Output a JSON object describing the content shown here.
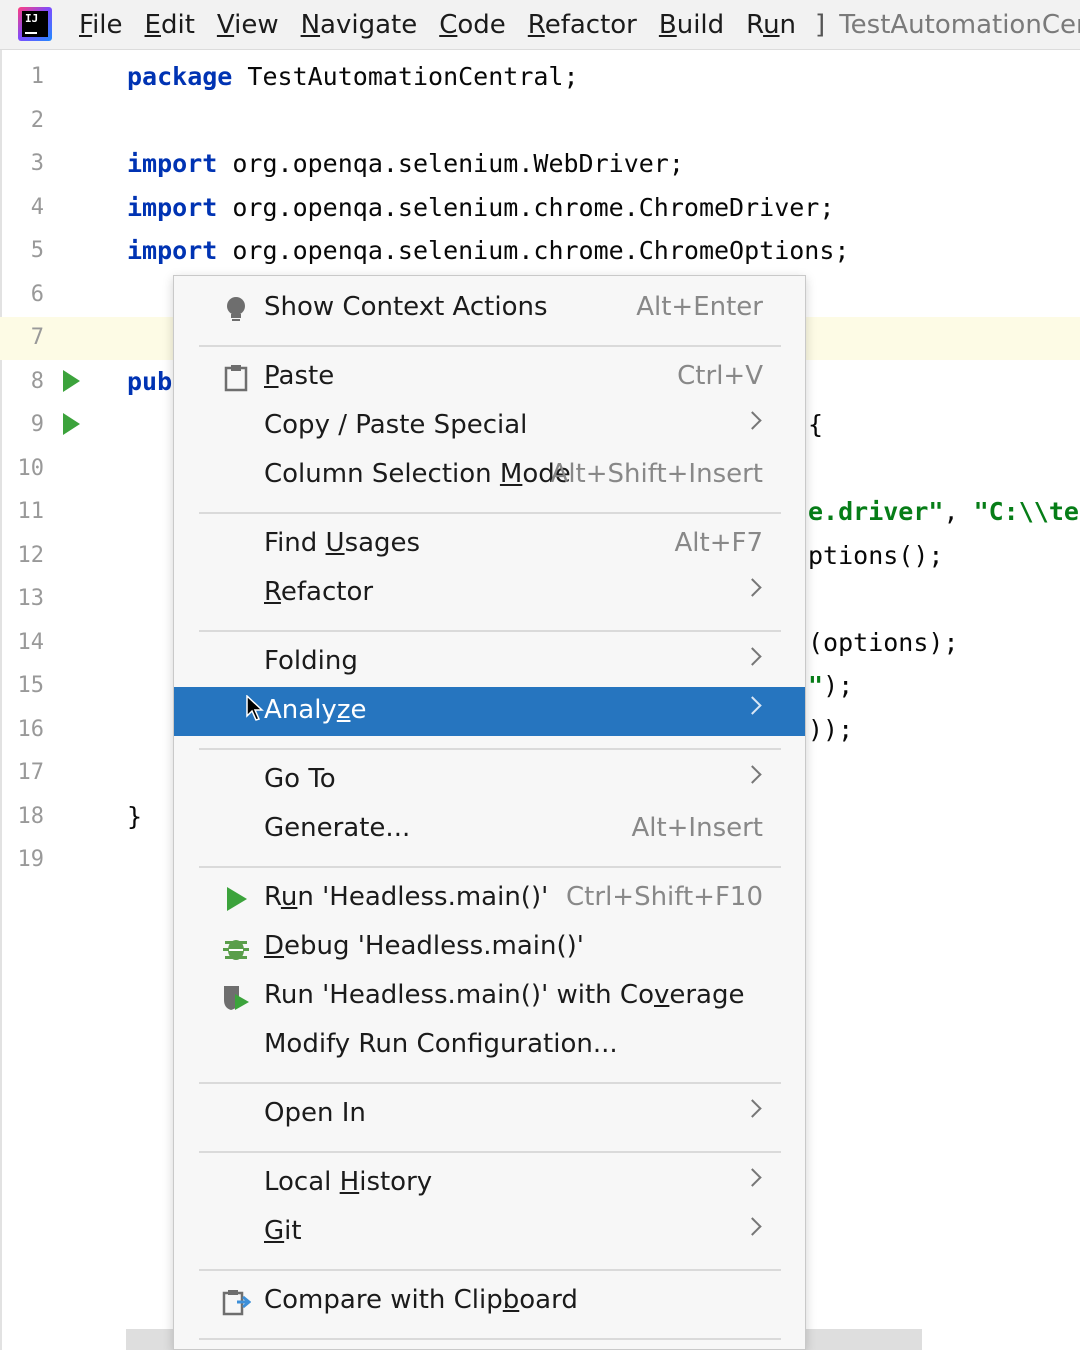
{
  "menubar": {
    "logo_text": "IJ",
    "items": [
      {
        "pre": "",
        "u": "F",
        "post": "ile"
      },
      {
        "pre": "",
        "u": "E",
        "post": "dit"
      },
      {
        "pre": "",
        "u": "V",
        "post": "iew"
      },
      {
        "pre": "",
        "u": "N",
        "post": "avigate"
      },
      {
        "pre": "",
        "u": "C",
        "post": "ode"
      },
      {
        "pre": "",
        "u": "R",
        "post": "efactor"
      },
      {
        "pre": "",
        "u": "B",
        "post": "uild"
      },
      {
        "pre": "R",
        "u": "u",
        "post": "n"
      }
    ],
    "separator": "]",
    "window_title": "TestAutomationCentra"
  },
  "editor": {
    "lines": [
      {
        "n": "1",
        "tokens": [
          {
            "t": "package",
            "k": "kw"
          },
          {
            "t": " TestAutomationCentral;",
            "k": ""
          }
        ]
      },
      {
        "n": "2",
        "tokens": []
      },
      {
        "n": "3",
        "tokens": [
          {
            "t": "import",
            "k": "kw"
          },
          {
            "t": " org.openqa.selenium.WebDriver;",
            "k": ""
          }
        ]
      },
      {
        "n": "4",
        "tokens": [
          {
            "t": "import",
            "k": "kw"
          },
          {
            "t": " org.openqa.selenium.chrome.ChromeDriver;",
            "k": ""
          }
        ]
      },
      {
        "n": "5",
        "tokens": [
          {
            "t": "import",
            "k": "kw"
          },
          {
            "t": " org.openqa.selenium.chrome.ChromeOptions;",
            "k": ""
          }
        ]
      },
      {
        "n": "6",
        "tokens": []
      },
      {
        "n": "7",
        "tokens": [],
        "current": true
      },
      {
        "n": "8",
        "tokens": [
          {
            "t": "pub",
            "k": "kw"
          }
        ],
        "run": true
      },
      {
        "n": "9",
        "tokens": [],
        "run": true,
        "right": [
          {
            "t": "{",
            "k": ""
          }
        ]
      },
      {
        "n": "10",
        "tokens": []
      },
      {
        "n": "11",
        "tokens": [],
        "right": [
          {
            "t": "e.driver\"",
            "k": "str"
          },
          {
            "t": ", ",
            "k": ""
          },
          {
            "t": "\"C:\\\\te",
            "k": "str"
          }
        ]
      },
      {
        "n": "12",
        "tokens": [],
        "right": [
          {
            "t": "ptions();",
            "k": ""
          }
        ]
      },
      {
        "n": "13",
        "tokens": []
      },
      {
        "n": "14",
        "tokens": [],
        "right": [
          {
            "t": "(options);",
            "k": ""
          }
        ]
      },
      {
        "n": "15",
        "tokens": [],
        "right": [
          {
            "t": "\"",
            "k": "str"
          },
          {
            "t": ");",
            "k": ""
          }
        ]
      },
      {
        "n": "16",
        "tokens": [],
        "right": [
          {
            "t": "));",
            "k": ""
          }
        ]
      },
      {
        "n": "17",
        "tokens": []
      },
      {
        "n": "18",
        "tokens": [
          {
            "t": "}",
            "k": ""
          }
        ]
      },
      {
        "n": "19",
        "tokens": []
      }
    ]
  },
  "context_menu": {
    "items": [
      {
        "type": "item",
        "pre": "Show Context Actions",
        "u": "",
        "post": "",
        "shortcut": "Alt+Enter",
        "icon": "lightbulb-icon"
      },
      {
        "type": "sep"
      },
      {
        "type": "item",
        "pre": "",
        "u": "P",
        "post": "aste",
        "shortcut": "Ctrl+V",
        "icon": "clipboard-icon"
      },
      {
        "type": "item",
        "pre": "Copy / Paste Special",
        "u": "",
        "post": "",
        "submenu": true
      },
      {
        "type": "item",
        "pre": "Column Selection ",
        "u": "M",
        "post": "ode",
        "shortcut": "Alt+Shift+Insert"
      },
      {
        "type": "sep"
      },
      {
        "type": "item",
        "pre": "Find ",
        "u": "U",
        "post": "sages",
        "shortcut": "Alt+F7"
      },
      {
        "type": "item",
        "pre": "",
        "u": "R",
        "post": "efactor",
        "submenu": true
      },
      {
        "type": "sep"
      },
      {
        "type": "item",
        "pre": "Folding",
        "u": "",
        "post": "",
        "submenu": true
      },
      {
        "type": "item",
        "pre": "Analy",
        "u": "z",
        "post": "e",
        "submenu": true,
        "selected": true
      },
      {
        "type": "sep"
      },
      {
        "type": "item",
        "pre": "Go To",
        "u": "",
        "post": "",
        "submenu": true
      },
      {
        "type": "item",
        "pre": "Generate...",
        "u": "",
        "post": "",
        "shortcut": "Alt+Insert"
      },
      {
        "type": "sep"
      },
      {
        "type": "item",
        "pre": "R",
        "u": "u",
        "post": "n 'Headless.main()'",
        "shortcut": "Ctrl+Shift+F10",
        "icon": "run-icon"
      },
      {
        "type": "item",
        "pre": "",
        "u": "D",
        "post": "ebug 'Headless.main()'",
        "icon": "debug-icon"
      },
      {
        "type": "item",
        "pre": "Run 'Headless.main()' with Co",
        "u": "v",
        "post": "erage",
        "icon": "coverage-icon"
      },
      {
        "type": "item",
        "pre": "Modify Run Configuration...",
        "u": "",
        "post": ""
      },
      {
        "type": "sep"
      },
      {
        "type": "item",
        "pre": "Open In",
        "u": "",
        "post": "",
        "submenu": true
      },
      {
        "type": "sep"
      },
      {
        "type": "item",
        "pre": "Local ",
        "u": "H",
        "post": "istory",
        "submenu": true
      },
      {
        "type": "item",
        "pre": "",
        "u": "G",
        "post": "it",
        "submenu": true
      },
      {
        "type": "sep"
      },
      {
        "type": "item",
        "pre": "Compare with Clip",
        "u": "b",
        "post": "oard",
        "icon": "compare-clipboard-icon"
      },
      {
        "type": "sep"
      }
    ]
  }
}
